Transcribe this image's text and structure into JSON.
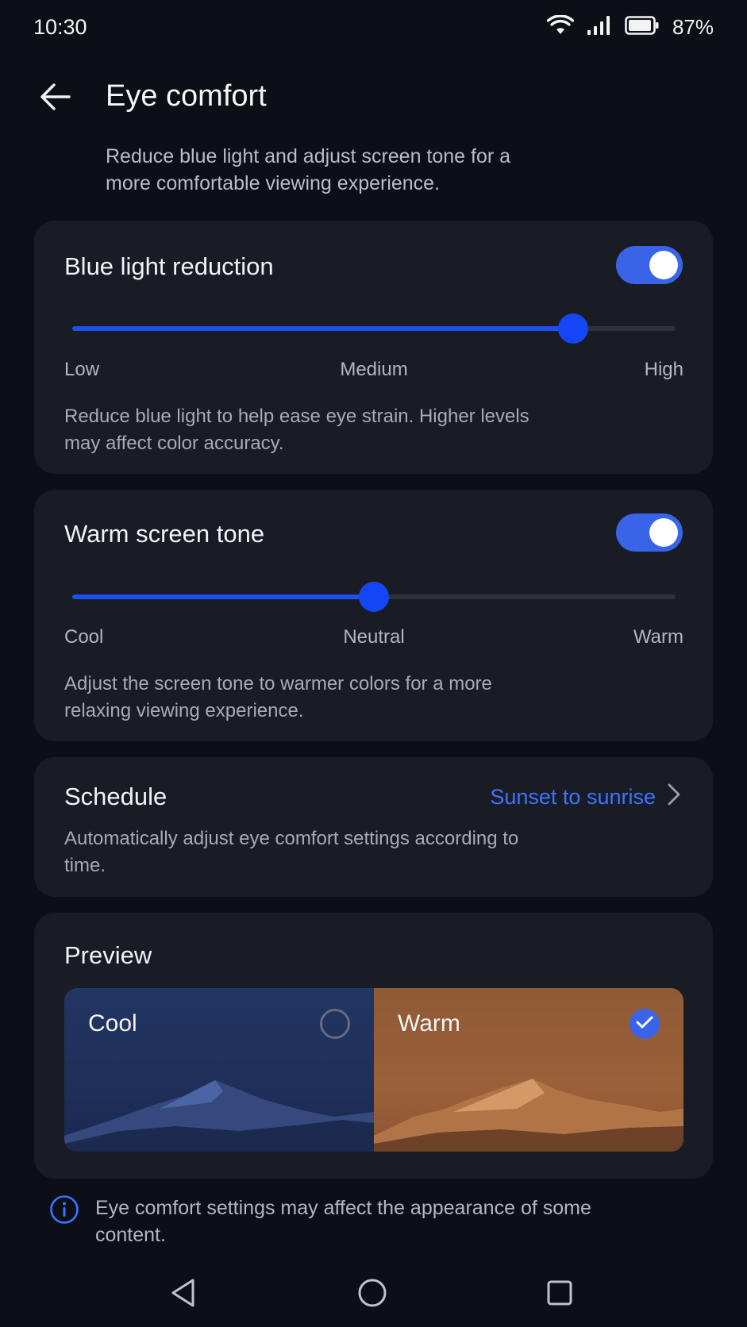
{
  "status_bar": {
    "time": "10:30",
    "battery": "87%"
  },
  "header": {
    "title": "Eye comfort",
    "subtitle": "Reduce blue light and adjust screen tone for a more comfortable viewing experience."
  },
  "blue_light": {
    "title": "Blue light reduction",
    "enabled": true,
    "level": 0.83,
    "labels": [
      "Low",
      "Medium",
      "High"
    ],
    "description": "Reduce blue light to help ease eye strain. Higher levels may affect color accuracy."
  },
  "warm_tone": {
    "title": "Warm screen tone",
    "enabled": true,
    "level": 0.5,
    "labels": [
      "Cool",
      "Neutral",
      "Warm"
    ],
    "description": "Adjust the screen tone to warmer colors for a more relaxing viewing experience."
  },
  "schedule": {
    "title": "Schedule",
    "value": "Sunset to sunrise",
    "description": "Automatically adjust eye comfort settings according to time."
  },
  "preview": {
    "title": "Preview",
    "options": [
      {
        "label": "Cool",
        "selected": false
      },
      {
        "label": "Warm",
        "selected": true
      }
    ]
  },
  "info": {
    "text": "Eye comfort settings may affect the appearance of some content."
  },
  "colors": {
    "accent": "#3a64e8",
    "link": "#3d73ff",
    "card_bg": "#191c24",
    "page_bg": "#0c0f15"
  },
  "icons": {
    "back": "arrow-left-icon",
    "wifi": "wifi-icon",
    "signal": "signal-icon",
    "battery": "battery-icon",
    "chevron": "chevron-right-icon",
    "info": "info-icon",
    "check": "check-icon"
  }
}
